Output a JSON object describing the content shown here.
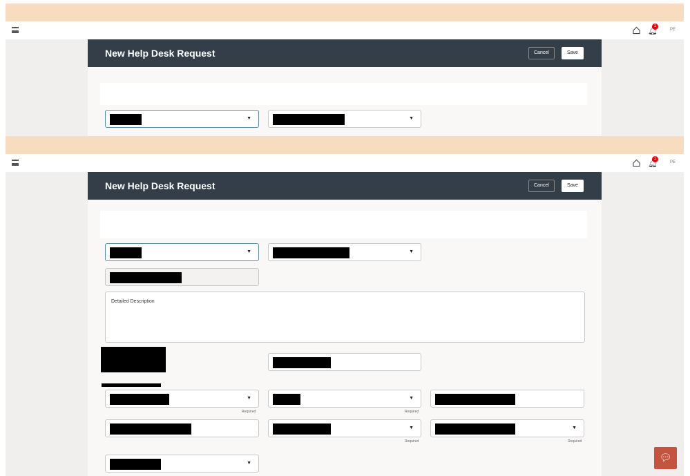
{
  "header": {
    "title": "New Help Desk Request",
    "cancel_label": "Cancel",
    "save_label": "Save"
  },
  "nav": {
    "notification_count": "1",
    "avatar_initials": "PE"
  },
  "form": {
    "description_label": "Detailed Description",
    "required_label": "Required"
  },
  "colors": {
    "header_bg": "#333e48",
    "banner": "#f8dcc0",
    "chat_button": "#c4533f"
  }
}
